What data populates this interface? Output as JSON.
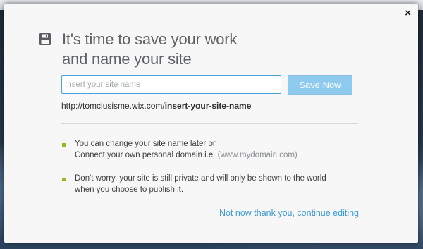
{
  "modal": {
    "close_symbol": "×",
    "icon": "floppy-disk-icon",
    "title_line1": "It's time to save your work",
    "title_line2": "and name your site",
    "input_placeholder": "Insert your site name",
    "input_value": "",
    "save_button_label": "Save Now",
    "url_prefix": "http://tomclusisme.wix.com/",
    "url_slug": "insert-your-site-name",
    "info1_line1": "You can change your site name later or",
    "info1_line2_text": "Connect your own personal domain i.e. ",
    "info1_line2_example": "(www.mydomain.com)",
    "info2_line1": "Don't worry, your site is still private and will only be shown to the world",
    "info2_line2": "when you choose to publish it.",
    "continue_link": "Not now thank you, continue editing"
  },
  "colors": {
    "accent_blue": "#3d9ad7",
    "save_button_bg": "#8ecaee",
    "input_border": "#4aa0dd",
    "bullet_green": "#8cbf26",
    "title_gray": "#5e6266"
  }
}
